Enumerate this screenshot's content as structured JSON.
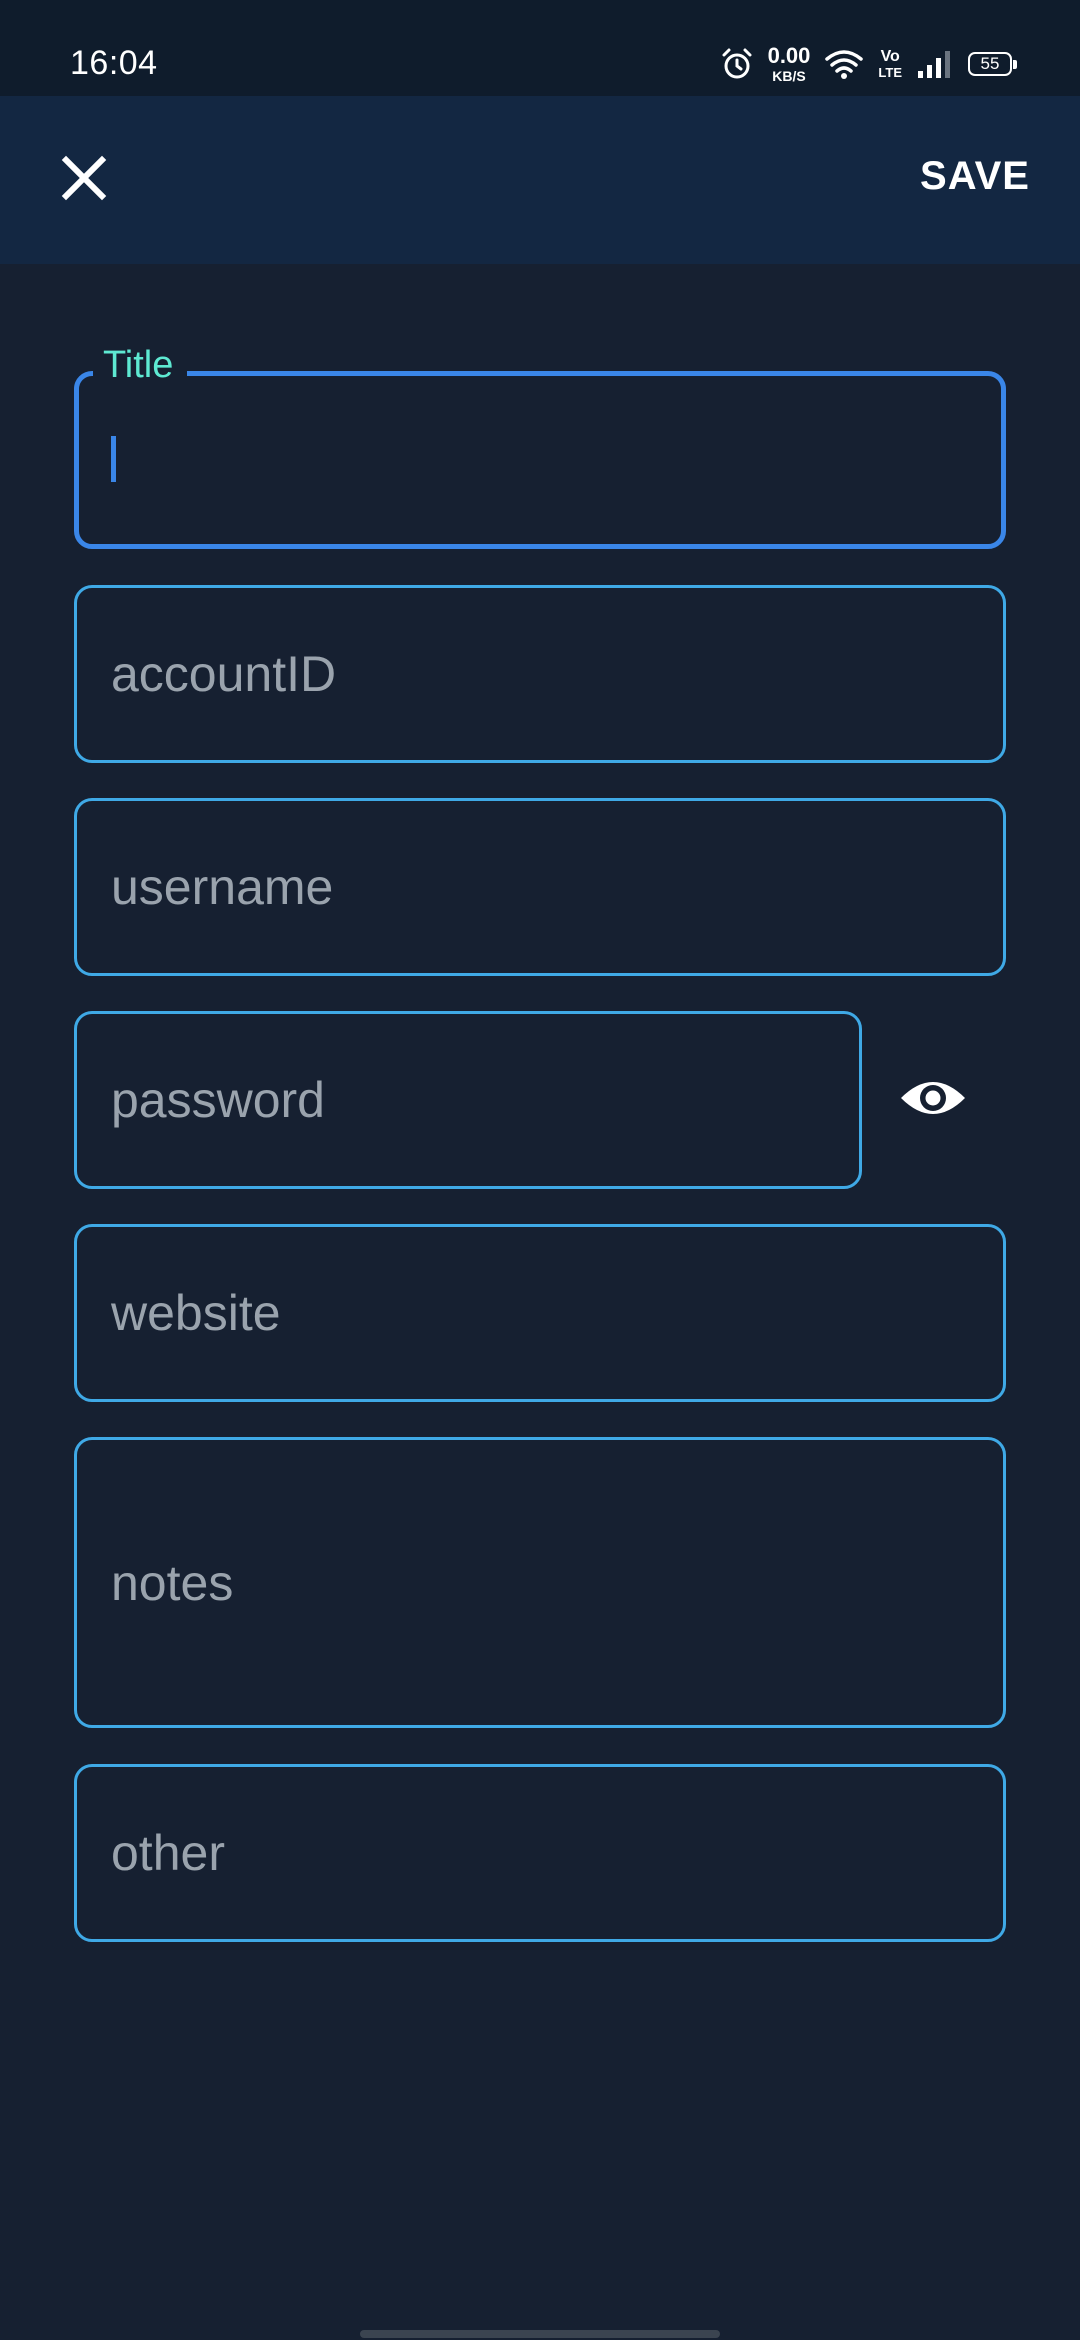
{
  "status_bar": {
    "time": "16:04",
    "net_speed_value": "0.00",
    "net_speed_unit": "KB/S",
    "volte_top": "Vo",
    "volte_bottom": "LTE",
    "battery": "55",
    "icons": [
      "alarm-icon",
      "wifi-icon",
      "signal-icon",
      "battery-icon"
    ]
  },
  "app_bar": {
    "close_icon": "close-icon",
    "save_label": "SAVE"
  },
  "form": {
    "title_label": "Title",
    "title_value": "",
    "accountid_placeholder": "accountID",
    "username_placeholder": "username",
    "password_placeholder": "password",
    "password_toggle_icon": "eye-icon",
    "website_placeholder": "website",
    "notes_placeholder": "notes",
    "other_placeholder": "other"
  },
  "colors": {
    "background": "#162031",
    "app_bar": "#132742",
    "status_bar": "#0f1c2c",
    "field_border": "#3fa9e6",
    "focused_border": "#3a86e8",
    "focused_label": "#5ee9d2",
    "placeholder": "#9aa3ad"
  }
}
